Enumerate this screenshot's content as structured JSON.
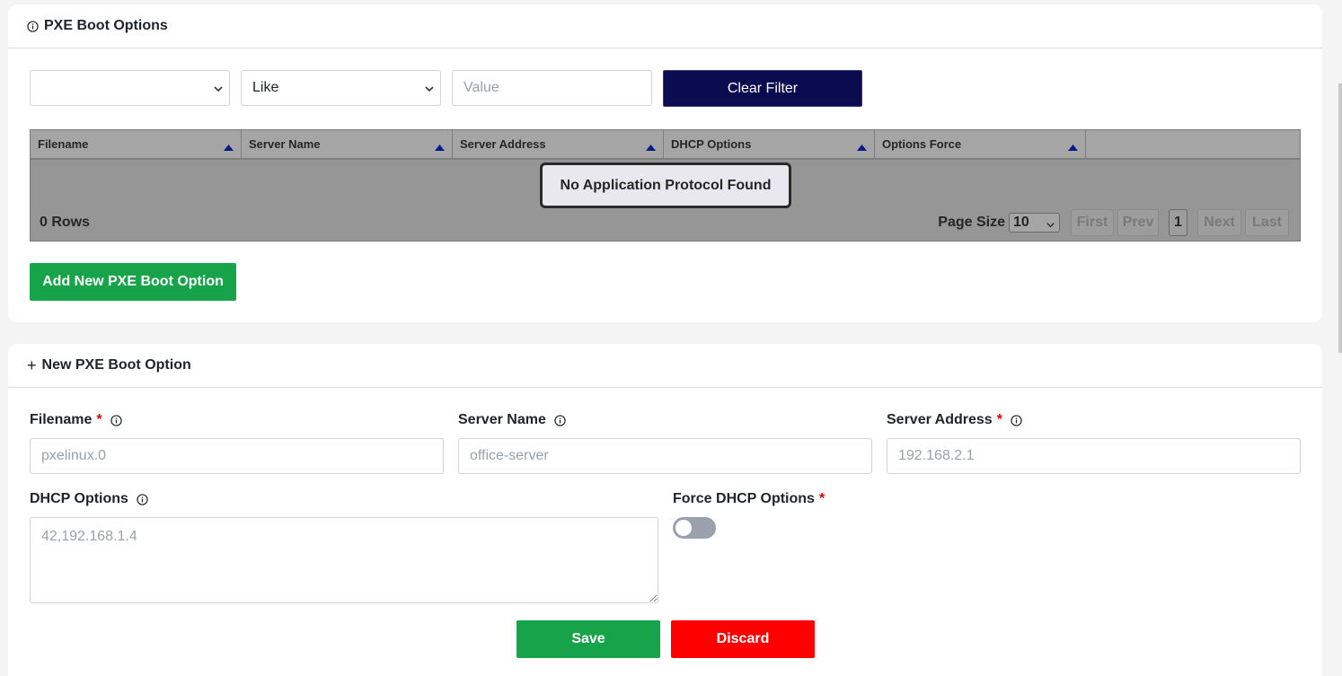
{
  "list_panel": {
    "title": "PXE Boot Options",
    "filter": {
      "field_value": "",
      "operator_value": "Like",
      "value_placeholder": "Value",
      "clear_label": "Clear Filter"
    },
    "table": {
      "columns": [
        "Filename",
        "Server Name",
        "Server Address",
        "DHCP Options",
        "Options Force"
      ],
      "empty_message": "No Application Protocol Found",
      "rows_count": "0 Rows",
      "page_size_label": "Page Size",
      "page_size_value": "10",
      "first_label": "First",
      "prev_label": "Prev",
      "current_page": "1",
      "next_label": "Next",
      "last_label": "Last"
    },
    "add_button_label": "Add New PXE Boot Option"
  },
  "form_panel": {
    "title": "New PXE Boot Option",
    "filename": {
      "label": "Filename",
      "required": "*",
      "placeholder": "pxelinux.0"
    },
    "server_name": {
      "label": "Server Name",
      "placeholder": "office-server"
    },
    "server_address": {
      "label": "Server Address",
      "required": "*",
      "placeholder": "192.168.2.1"
    },
    "dhcp_options": {
      "label": "DHCP Options",
      "placeholder": "42,192.168.1.4"
    },
    "force_dhcp": {
      "label": "Force DHCP Options",
      "required": "*",
      "enabled": false
    },
    "save_label": "Save",
    "discard_label": "Discard"
  },
  "colors": {
    "navy_button": "#0b0b4f",
    "green_button": "#16a34a",
    "red_button": "#ff0000",
    "required_star": "#e00000"
  }
}
